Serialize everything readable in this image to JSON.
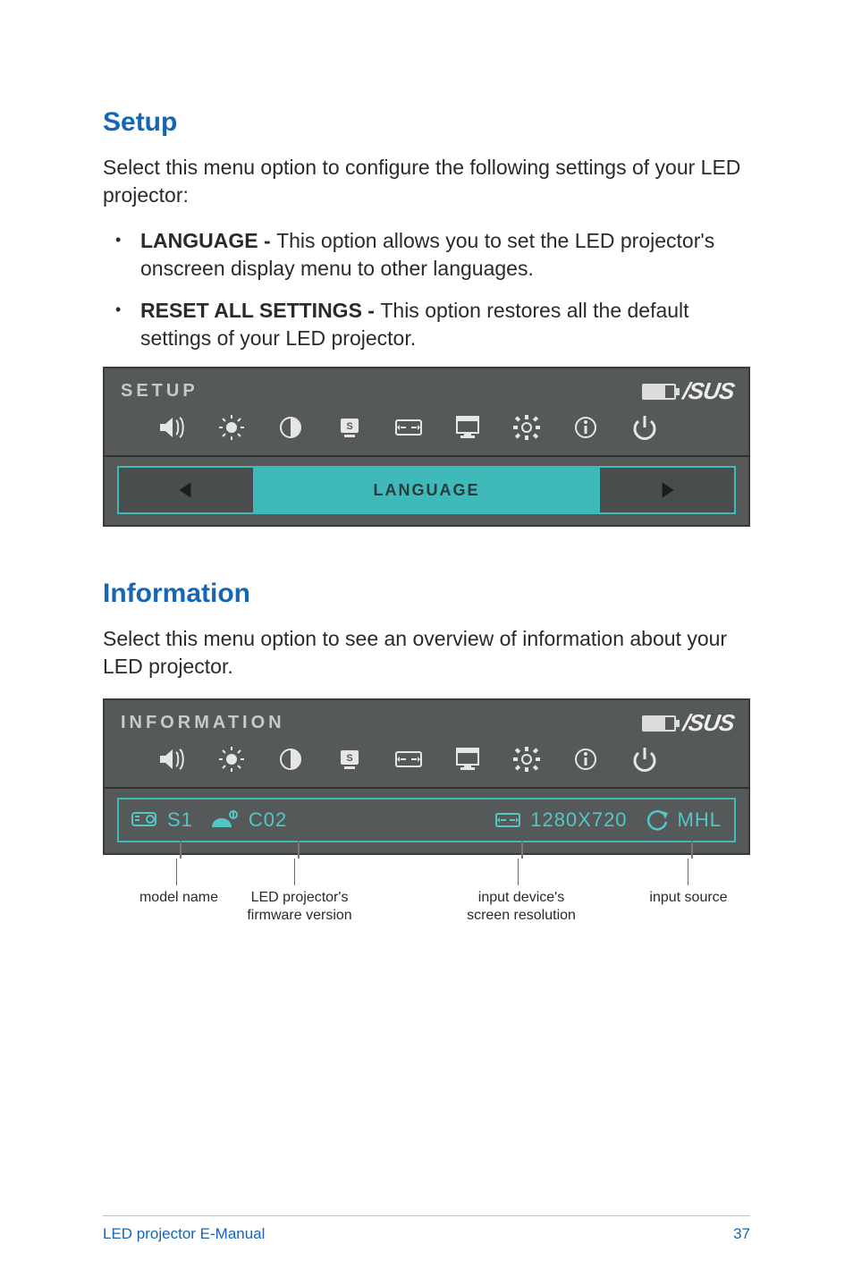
{
  "setup": {
    "heading": "Setup",
    "intro": "Select this menu option to configure the following settings of your LED projector:",
    "items": [
      {
        "term": "LANGUAGE - ",
        "desc": "This option allows you to set the LED projector's onscreen display menu to other languages."
      },
      {
        "term": "RESET ALL SETTINGS - ",
        "desc": "This option restores all the default settings of your LED projector."
      }
    ],
    "osd_title": "SETUP",
    "osd_selected": "LANGUAGE"
  },
  "information": {
    "heading": "Information",
    "intro": "Select this menu option to see an overview of information about your LED projector.",
    "osd_title": "INFORMATION",
    "model": "S1",
    "firmware": "C02",
    "resolution": "1280X720",
    "source": "MHL",
    "callouts": {
      "model": "model name",
      "firmware": "LED projector's firmware version",
      "resolution": "input device's screen resolution",
      "source": "input source"
    }
  },
  "brand": "/SUS",
  "footer": {
    "left": "LED projector E-Manual",
    "page": "37"
  }
}
